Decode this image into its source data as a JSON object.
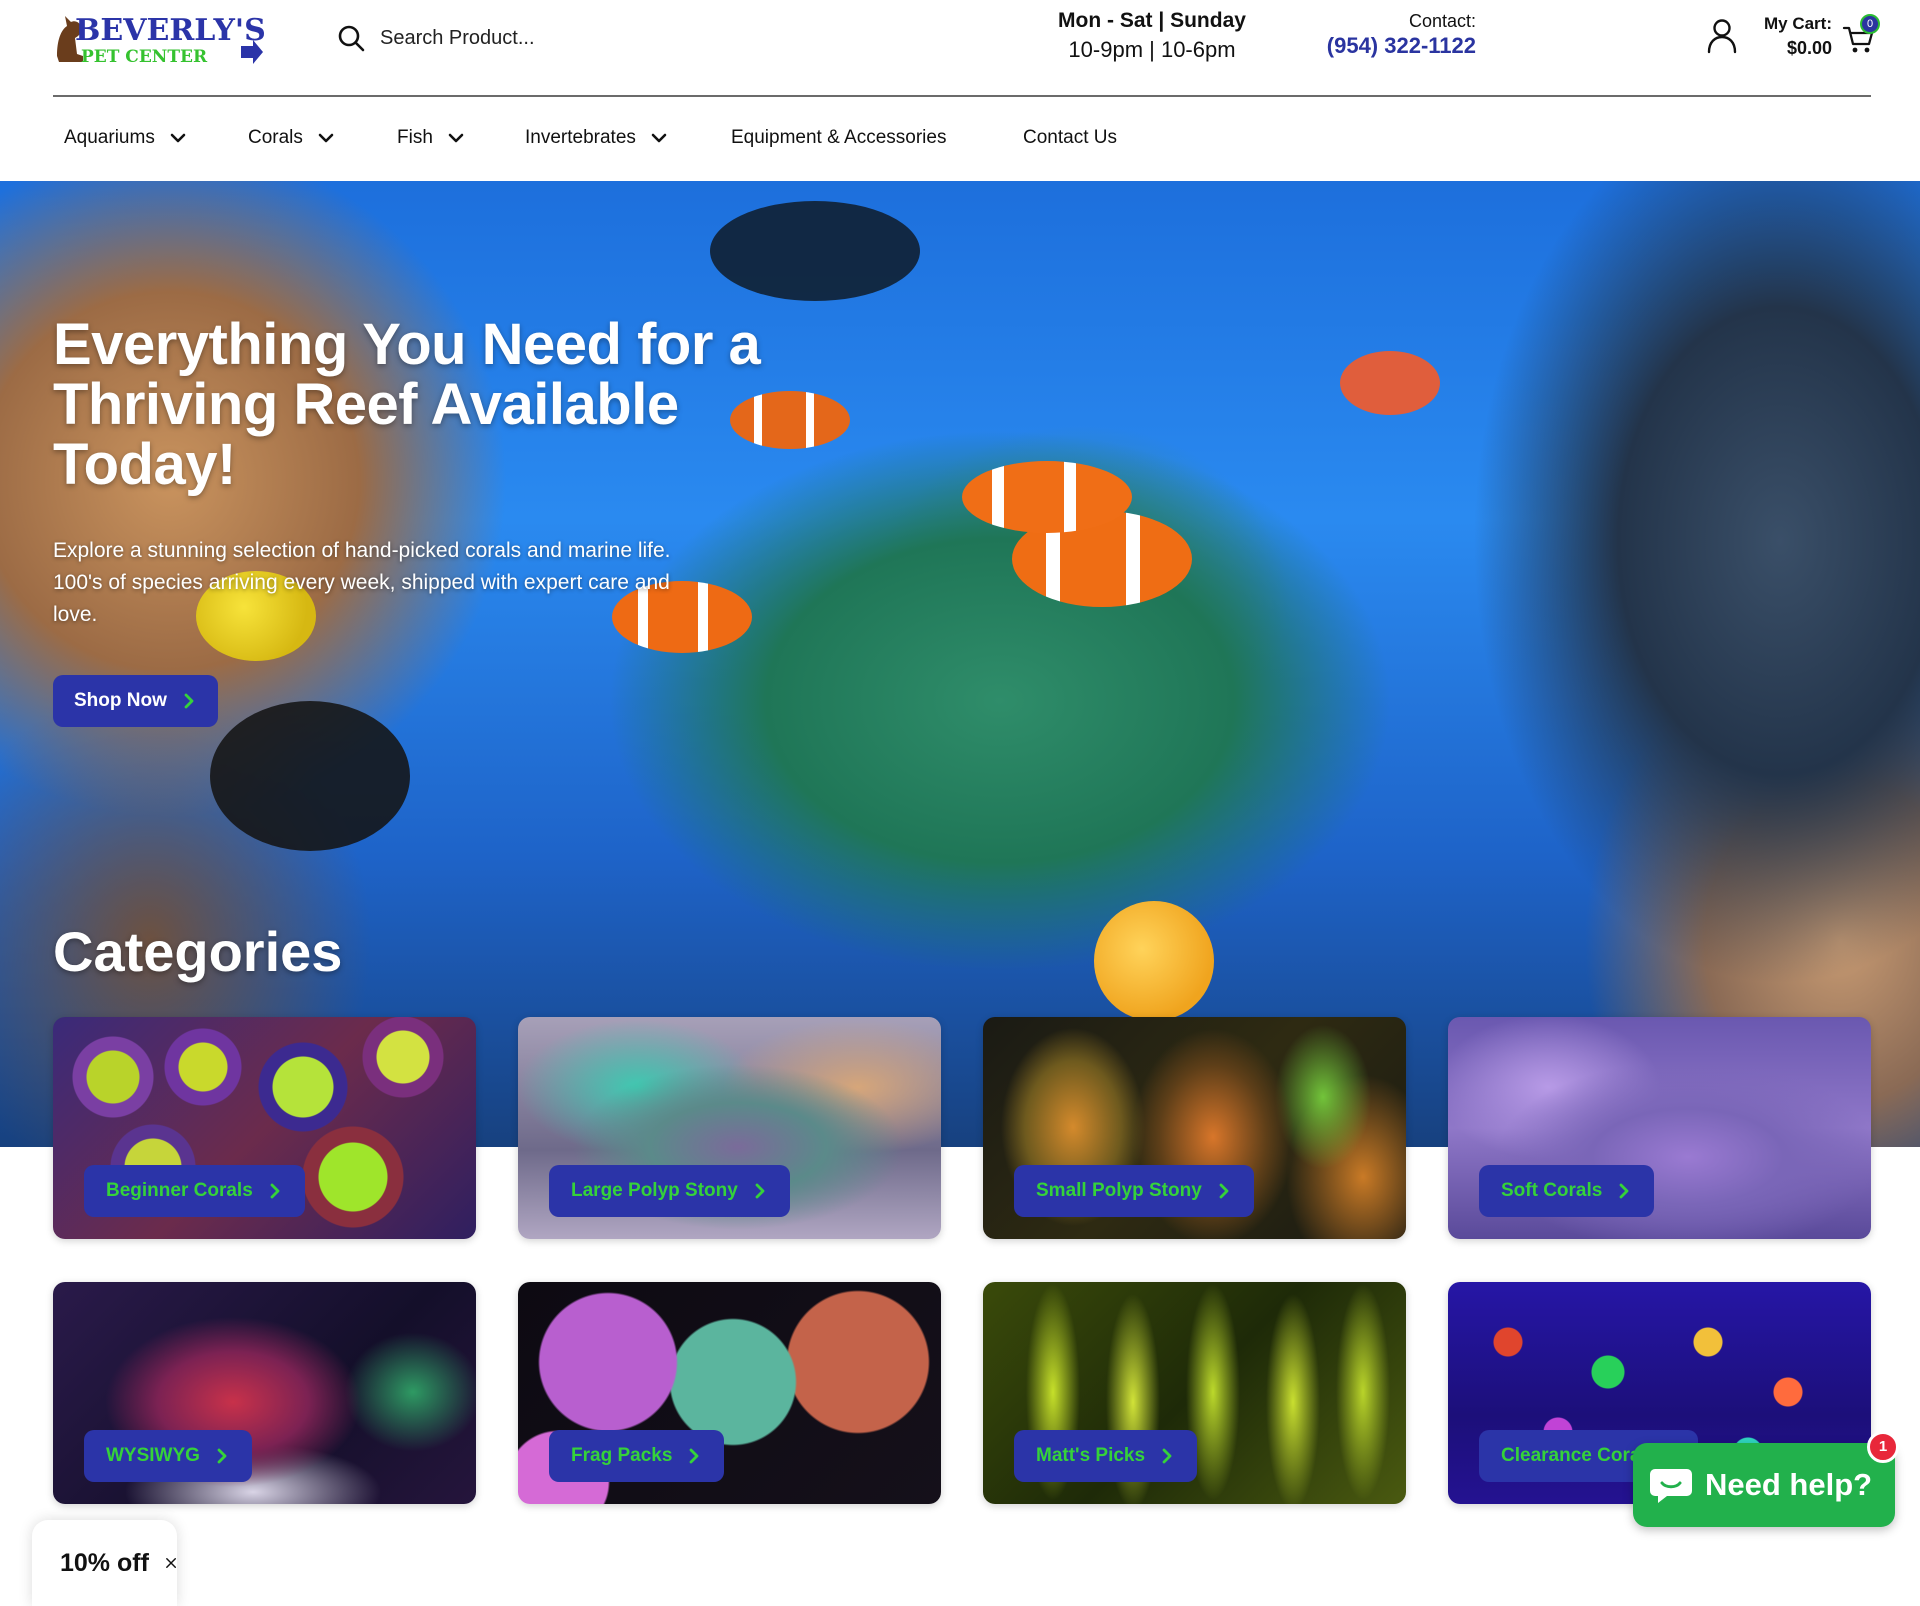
{
  "header": {
    "logo_text": "BEVERLY'S",
    "logo_subtext": "PET CENTER",
    "search_placeholder": "Search Product...",
    "hours": {
      "days": "Mon - Sat | Sunday",
      "times": "10-9pm | 10-6pm"
    },
    "contact": {
      "label": "Contact:",
      "phone": "(954) 322-1122"
    },
    "cart": {
      "label": "My Cart:",
      "amount": "$0.00",
      "count": "0"
    },
    "icons": {
      "search": "search-icon",
      "account": "user-icon",
      "cart": "cart-icon"
    }
  },
  "nav": {
    "items": [
      {
        "label": "Aquariums",
        "dropdown": true
      },
      {
        "label": "Corals",
        "dropdown": true
      },
      {
        "label": "Fish",
        "dropdown": true
      },
      {
        "label": "Invertebrates",
        "dropdown": true
      },
      {
        "label": "Equipment & Accessories",
        "dropdown": false
      },
      {
        "label": "Contact Us",
        "dropdown": false
      }
    ]
  },
  "hero": {
    "title": "Everything You Need for a Thriving Reef Available Today!",
    "description": "Explore a stunning selection of hand-picked corals and marine life. 100's of species arriving every week, shipped with expert care and love.",
    "cta": "Shop Now"
  },
  "categories": {
    "title": "Categories",
    "items": [
      {
        "label": "Beginner Corals"
      },
      {
        "label": "Large Polyp Stony"
      },
      {
        "label": "Small Polyp Stony"
      },
      {
        "label": "Soft Corals"
      },
      {
        "label": "WYSIWYG"
      },
      {
        "label": "Frag Packs"
      },
      {
        "label": "Matt's Picks"
      },
      {
        "label": "Clearance Coral"
      }
    ]
  },
  "widgets": {
    "chat": {
      "label": "Need help?",
      "badge": "1",
      "icon": "chat-bubble-icon"
    },
    "discount": {
      "label": "10% off",
      "icon": "close-icon"
    }
  },
  "colors": {
    "brand_blue": "#2b34a8",
    "brand_green": "#35d23a",
    "phone_blue": "#2a34a0",
    "chat_green": "#22b14c",
    "badge_red": "#e8273a"
  }
}
